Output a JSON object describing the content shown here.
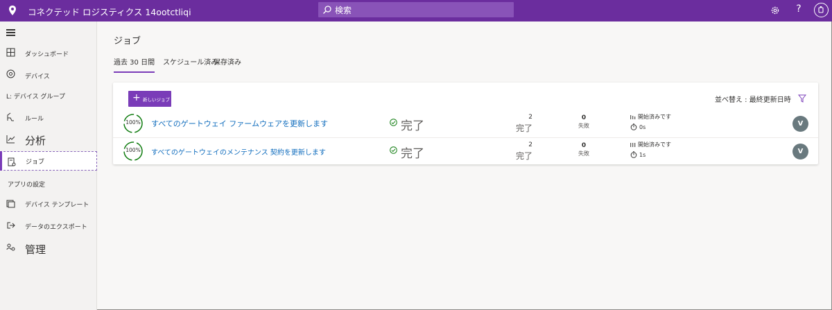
{
  "app": {
    "title": "コネクテッド ロジスティクス 14ootctliqi"
  },
  "search": {
    "placeholder": "検索"
  },
  "header": {
    "help_label": "?"
  },
  "sidebar": {
    "items": [
      {
        "label": "ダッシュボード",
        "icon": "dashboard-icon"
      },
      {
        "label": "デバイス",
        "icon": "device-icon"
      },
      {
        "label": "L: デバイス グループ",
        "icon": ""
      },
      {
        "label": "ルール",
        "icon": "rules-icon"
      },
      {
        "label": "分析",
        "icon": "analytics-icon"
      },
      {
        "label": "ジョブ",
        "icon": "jobs-icon"
      }
    ],
    "section_label": "アプリの設定",
    "settings_items": [
      {
        "label": "デバイス テンプレート",
        "icon": "device-template-icon"
      },
      {
        "label": "データのエクスポート",
        "icon": "data-export-icon"
      },
      {
        "label": "管理",
        "icon": "admin-icon"
      }
    ]
  },
  "main": {
    "title": "ジョブ",
    "tabs": [
      {
        "label": "過去 30 日間"
      },
      {
        "label": "スケジュール済み"
      },
      {
        "label": "保存済み"
      }
    ],
    "new_job_button": "新しいジョブ",
    "sort_label": "並べ替え : 最終更新日時",
    "jobs": [
      {
        "progress": "100%",
        "name": "すべてのゲートウェイ ファームウェアを更新します",
        "status": "完了",
        "completed_count": "2",
        "completed_label": "完了",
        "failed_count": "0",
        "failed_label": "失敗",
        "started_label": "開始済みです",
        "duration": "0s",
        "avatar": "V"
      },
      {
        "progress": "100%",
        "name": "すべてのゲートウェイのメンテナンス 契約を更新します",
        "status": "完了",
        "completed_count": "2",
        "completed_label": "完了",
        "failed_count": "0",
        "failed_label": "失敗",
        "started_label": "開始済みです",
        "duration": "1s",
        "avatar": "V"
      }
    ]
  },
  "colors": {
    "brand": "#6b2d9e",
    "accent": "#7a3cb8",
    "success": "#107c10",
    "link": "#0f6cbd"
  }
}
